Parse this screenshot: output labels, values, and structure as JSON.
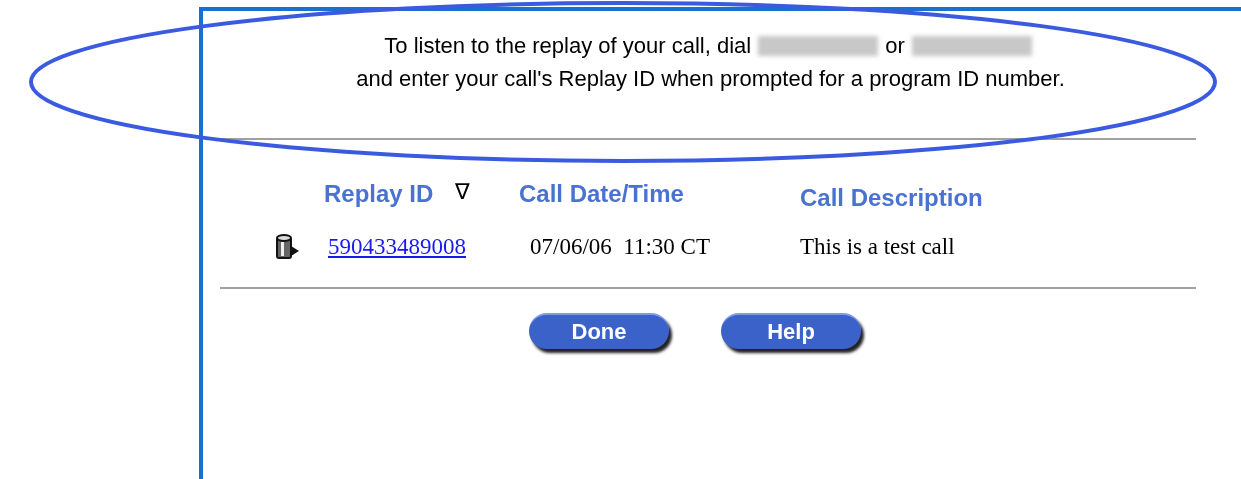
{
  "instructions": {
    "line_1_before": "To listen to the replay of your call, dial",
    "line_1_between": "or",
    "line_2": "and enter your call's Replay ID when prompted for a program ID number."
  },
  "table": {
    "columns": [
      {
        "label": "Replay ID",
        "sort_indicator": "∇"
      },
      {
        "label": "Call Date/Time"
      },
      {
        "label": "Call Description"
      }
    ],
    "rows": [
      {
        "replay_id": "590433489008",
        "date_time": "07/06/06  11:30 CT",
        "description": "This is a test call"
      }
    ]
  },
  "buttons": [
    "Done",
    "Help"
  ]
}
